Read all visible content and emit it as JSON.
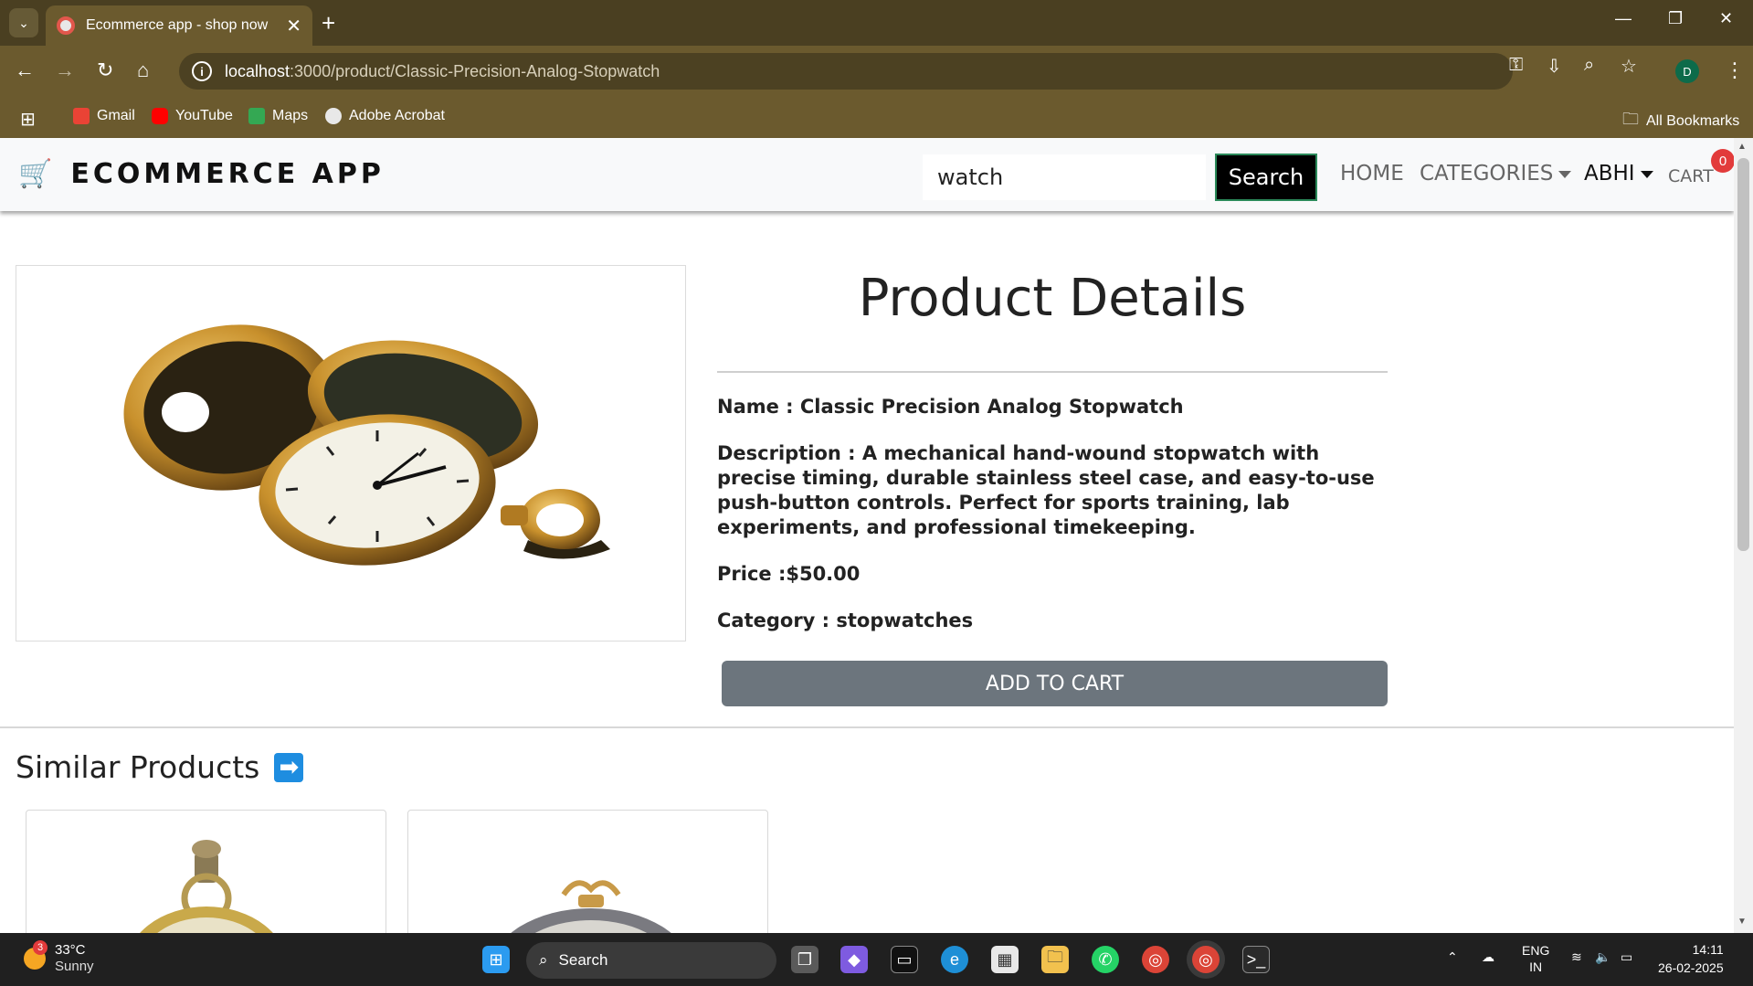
{
  "browser": {
    "tab_title": "Ecommerce app - shop now",
    "url_host": "localhost",
    "url_path": ":3000/product/Classic-Precision-Analog-Stopwatch",
    "bookmarks": [
      "Gmail",
      "YouTube",
      "Maps",
      "Adobe Acrobat"
    ],
    "all_bookmarks": "All Bookmarks",
    "profile_initial": "D"
  },
  "header": {
    "brand": "ECOMMERCE APP",
    "search_value": "watch",
    "search_button": "Search",
    "nav_home": "HOME",
    "nav_categories": "CATEGORIES",
    "nav_user": "ABHI",
    "nav_cart": "CART",
    "cart_count": "0"
  },
  "product": {
    "heading": "Product Details",
    "name_line": "Name : Classic Precision Analog Stopwatch",
    "description_line": "Description : A mechanical hand-wound stopwatch with precise timing, durable stainless steel case, and easy-to-use push-button controls. Perfect for sports training, lab experiments, and professional timekeeping.",
    "price_line": "Price :$50.00",
    "category_line": "Category : stopwatches",
    "add_to_cart": "ADD TO CART"
  },
  "similar": {
    "title": "Similar Products",
    "arrow": "➡"
  },
  "taskbar": {
    "weather_temp": "33°C",
    "weather_desc": "Sunny",
    "weather_badge": "3",
    "search_label": "Search",
    "lang_top": "ENG",
    "lang_bottom": "IN",
    "time": "14:11",
    "date": "26-02-2025"
  },
  "colors": {
    "chrome_dark": "#4a3f21",
    "chrome": "#6b5a2e",
    "add_to_cart_bg": "#6c757d",
    "cart_badge": "#e23b3b"
  }
}
